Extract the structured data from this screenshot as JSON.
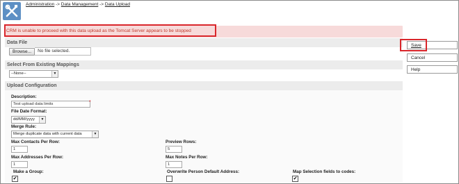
{
  "breadcrumb": [
    "Administration",
    "Data Management",
    "Data Upload"
  ],
  "breadcrumb_sep": "->",
  "alert": {
    "message": "CRM is unable to proceed with this data upload as the Tomcat Server appears to be stopped"
  },
  "data_file": {
    "heading": "Data File",
    "browse_label": "Browse...",
    "file_text": "No file selected."
  },
  "mappings": {
    "heading": "Select From Existing Mappings",
    "selected": "--None--"
  },
  "upload_config": {
    "heading": "Upload Configuration",
    "description_label": "Description:",
    "description_value": "Test upload data limits",
    "date_format_label": "File Date Format:",
    "date_format_value": "dd/MM/yyyy",
    "merge_rule_label": "Merge Rule:",
    "merge_rule_value": "Merge duplicate data with current data",
    "max_contacts_label": "Max Contacts Per Row:",
    "max_contacts_value": "1",
    "preview_rows_label": "Preview Rows:",
    "preview_rows_value": "5",
    "max_addresses_label": "Max Addresses Per Row:",
    "max_addresses_value": "1",
    "max_notes_label": "Max Notes Per Row:",
    "max_notes_value": "1",
    "make_group_label": "Make a Group:",
    "make_group_checked": true,
    "overwrite_address_label": "Overwrite Person Default Address:",
    "overwrite_address_checked": false,
    "map_selection_label": "Map Selection fields to codes:",
    "map_selection_checked": true
  },
  "sidebar": {
    "save_label": "Save",
    "cancel_label": "Cancel",
    "help_label": "Help"
  },
  "colors": {
    "alert_bg": "#f7dada",
    "alert_text": "#c0392b",
    "highlight": "#d9262b",
    "logo_bg": "#5d8fc4"
  },
  "icons": {
    "logo": "tools-icon",
    "select_arrow": "chevron-down-icon",
    "check": "checkmark-icon"
  }
}
